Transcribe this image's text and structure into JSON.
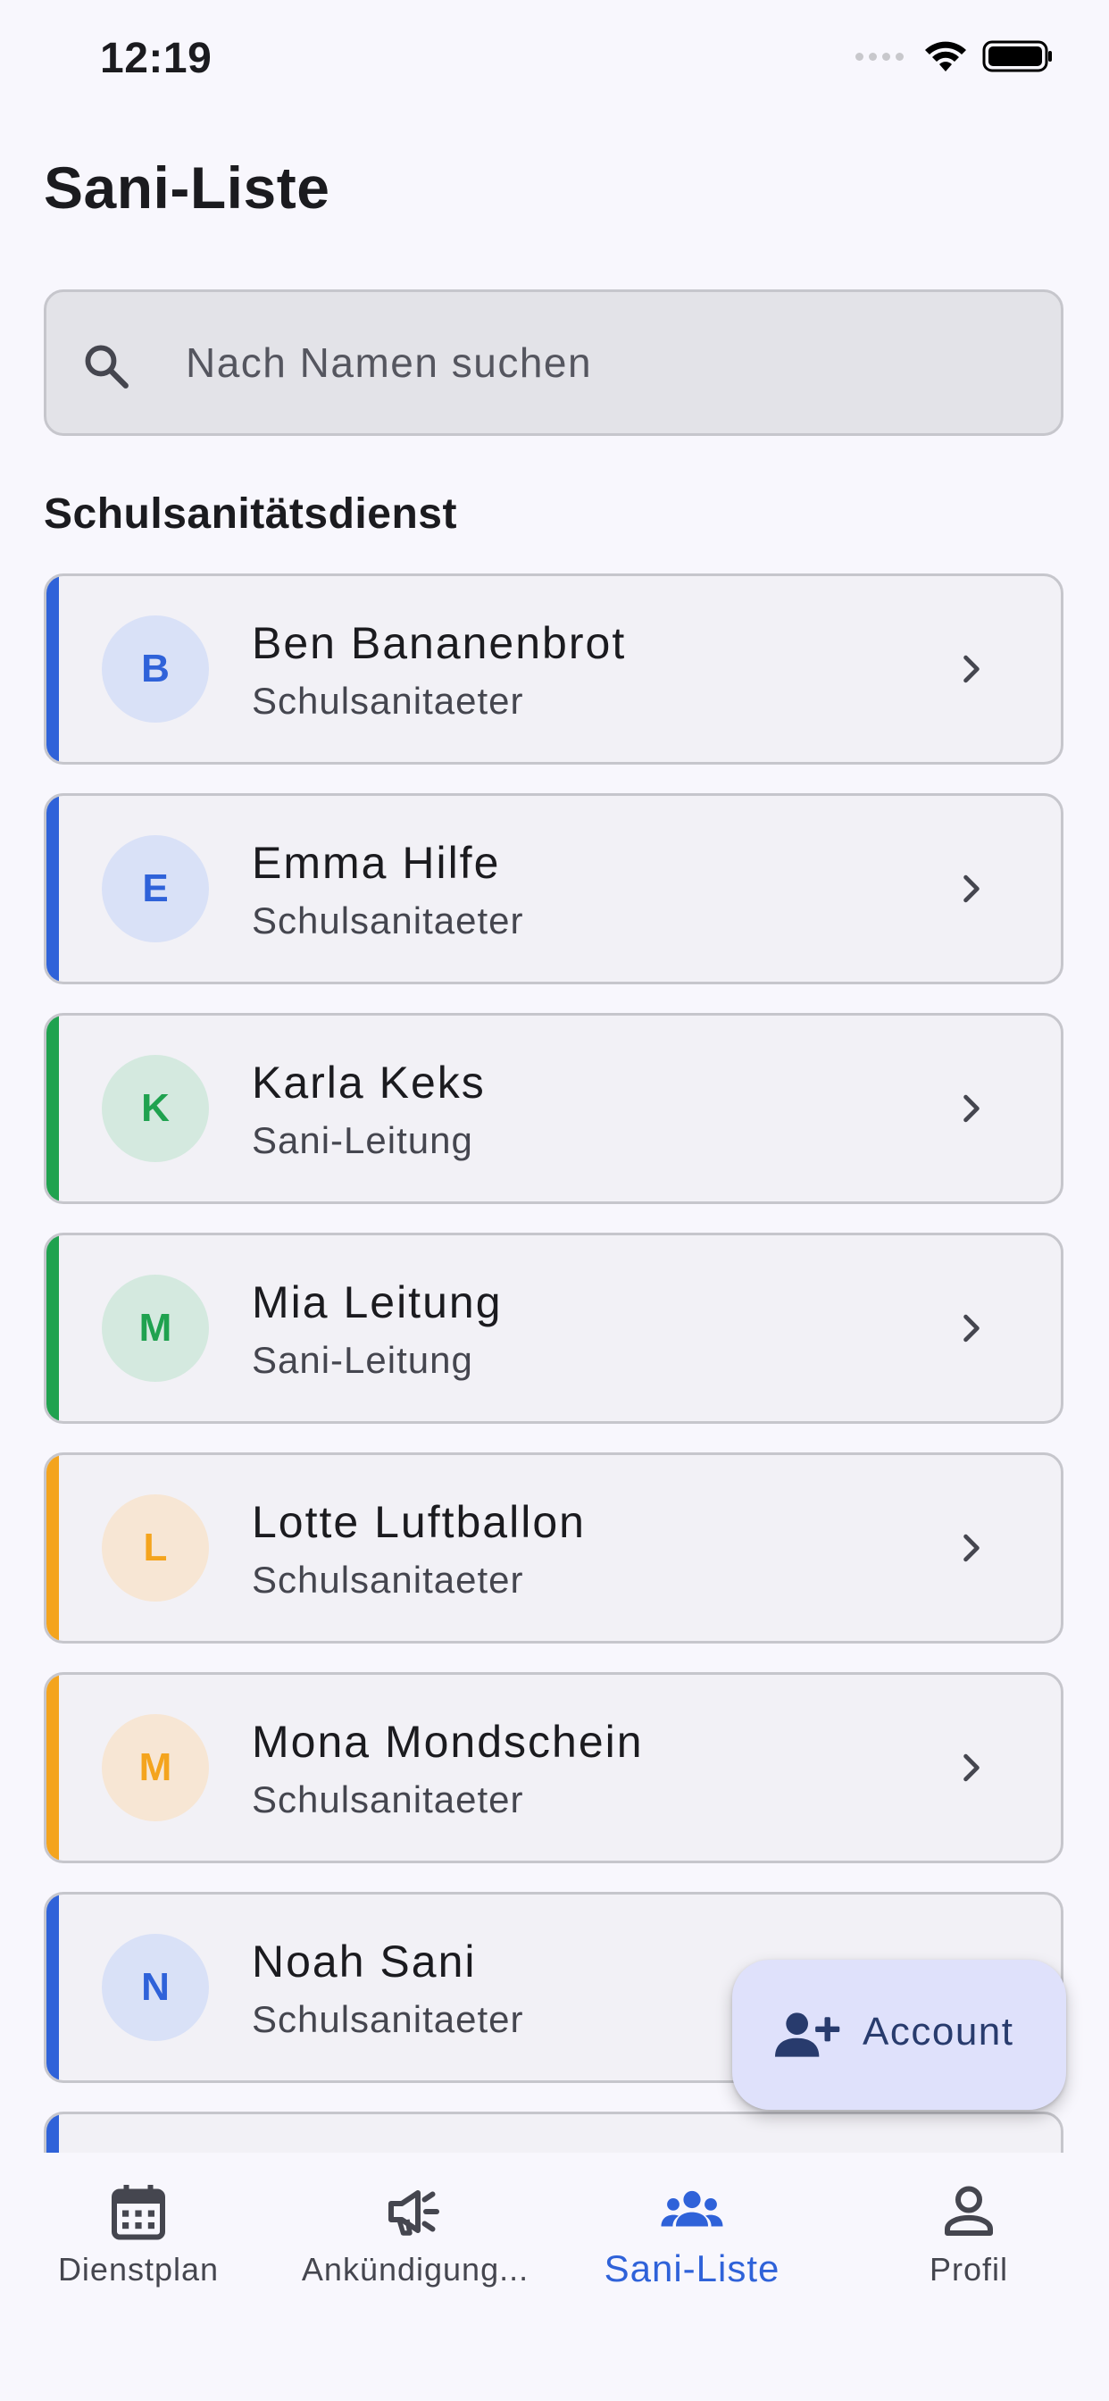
{
  "status_bar": {
    "time": "12:19"
  },
  "page": {
    "title": "Sani-Liste"
  },
  "search": {
    "placeholder": "Nach Namen suchen",
    "value": ""
  },
  "section": {
    "title": "Schulsanitätsdienst"
  },
  "colors": {
    "blue": "#2f62d9",
    "green": "#1fa24f",
    "orange": "#f4a41d",
    "blue_bg": "#d9e1f7",
    "green_bg": "#d4e9df",
    "orange_bg": "#f7e6d4"
  },
  "members": [
    {
      "initial": "B",
      "name": "Ben Bananenbrot",
      "role": "Schulsanitaeter",
      "accent": "#2f62d9",
      "avatar_bg": "#d9e1f7"
    },
    {
      "initial": "E",
      "name": "Emma Hilfe",
      "role": "Schulsanitaeter",
      "accent": "#2f62d9",
      "avatar_bg": "#d9e1f7"
    },
    {
      "initial": "K",
      "name": "Karla Keks",
      "role": "Sani-Leitung",
      "accent": "#1fa24f",
      "avatar_bg": "#d4e9df"
    },
    {
      "initial": "M",
      "name": "Mia Leitung",
      "role": "Sani-Leitung",
      "accent": "#1fa24f",
      "avatar_bg": "#d4e9df"
    },
    {
      "initial": "L",
      "name": "Lotte Luftballon",
      "role": "Schulsanitaeter",
      "accent": "#f4a41d",
      "avatar_bg": "#f7e6d4"
    },
    {
      "initial": "M",
      "name": "Mona Mondschein",
      "role": "Schulsanitaeter",
      "accent": "#f4a41d",
      "avatar_bg": "#f7e6d4"
    },
    {
      "initial": "N",
      "name": "Noah Sani",
      "role": "Schulsanitaeter",
      "accent": "#2f62d9",
      "avatar_bg": "#d9e1f7"
    },
    {
      "initial": "",
      "name": "",
      "role": "",
      "accent": "#2f62d9",
      "avatar_bg": "#d9e1f7"
    }
  ],
  "fab": {
    "label": "Account",
    "icon": "person-add-icon"
  },
  "nav": {
    "items": [
      {
        "label": "Dienstplan",
        "icon": "calendar-icon"
      },
      {
        "label": "Ankündigung...",
        "icon": "megaphone-icon"
      },
      {
        "label": "Sani-Liste",
        "icon": "group-icon",
        "active": true
      },
      {
        "label": "Profil",
        "icon": "person-icon"
      }
    ]
  }
}
